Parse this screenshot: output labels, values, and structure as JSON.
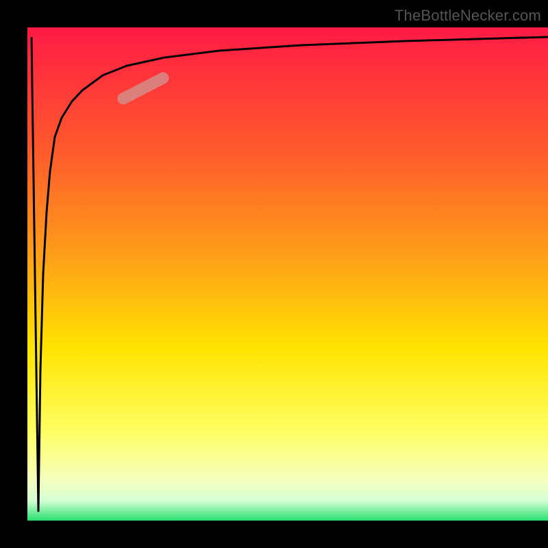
{
  "watermark": "TheBottleNecker.com",
  "chart_data": {
    "type": "line",
    "title": "",
    "xlabel": "",
    "ylabel": "",
    "xlim": [
      0,
      100
    ],
    "ylim": [
      0,
      100
    ],
    "background_gradient": {
      "direction": "vertical",
      "stops": [
        {
          "pos": 0.0,
          "color": "#ff1a44"
        },
        {
          "pos": 0.25,
          "color": "#ff5a2c"
        },
        {
          "pos": 0.45,
          "color": "#ff9a1a"
        },
        {
          "pos": 0.65,
          "color": "#ffe400"
        },
        {
          "pos": 0.82,
          "color": "#ffff64"
        },
        {
          "pos": 0.92,
          "color": "#f4ffc0"
        },
        {
          "pos": 0.96,
          "color": "#d4ffd4"
        },
        {
          "pos": 1.0,
          "color": "#28e070"
        }
      ]
    },
    "series": [
      {
        "name": "bottleneck-curve",
        "note": "V-shaped curve: sharp drop near x≈0 then asymptotic rise toward top-right. Values estimated from pixels (no axis ticks/labels present).",
        "x": [
          0.8,
          1.5,
          2.0,
          2.5,
          3.0,
          3.5,
          4.0,
          5.0,
          6.0,
          8.0,
          10.0,
          14.0,
          18.0,
          25.0,
          35.0,
          50.0,
          70.0,
          100.0
        ],
        "y": [
          98.0,
          40.0,
          2.0,
          30.0,
          50.0,
          62.0,
          70.0,
          78.0,
          82.0,
          86.0,
          88.5,
          91.0,
          92.5,
          94.0,
          95.5,
          96.8,
          97.6,
          98.2
        ]
      }
    ],
    "highlight_segment": {
      "note": "faded pink capsule marker on rising branch",
      "x_range": [
        17,
        25
      ],
      "y_range": [
        86,
        90
      ],
      "color": "#d38f8a"
    }
  }
}
